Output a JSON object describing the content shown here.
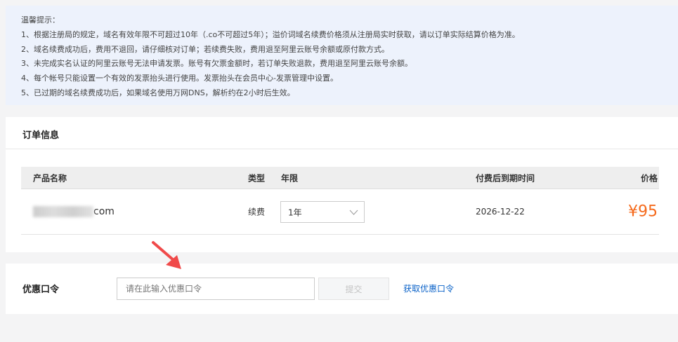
{
  "notice": {
    "title": "温馨提示：",
    "lines": [
      "1、根据注册局的规定，域名有效年限不可超过10年（.co不可超过5年）；溢价词域名续费价格须从注册局实时获取，请以订单实际结算价格为准。",
      "2、域名续费成功后，费用不退回，请仔细核对订单；若续费失败，费用退至阿里云账号余额或原付款方式。",
      "3、未完成实名认证的阿里云账号无法申请发票。账号有欠票金额时，若订单失败退款，费用退至阿里云账号余额。",
      "4、每个帐号只能设置一个有效的发票抬头进行使用。发票抬头在会员中心-发票管理中设置。",
      "5、已过期的域名续费成功后，如果域名使用万网DNS，解析约在2小时后生效。"
    ]
  },
  "order": {
    "title": "订单信息",
    "headers": {
      "product": "产品名称",
      "type": "类型",
      "years": "年限",
      "expiry": "付费后到期时间",
      "price": "价格"
    },
    "row": {
      "domain_suffix": "com",
      "type": "续费",
      "years": "1年",
      "expiry": "2026-12-22",
      "price": "¥95"
    }
  },
  "coupon": {
    "label": "优惠口令",
    "placeholder": "请在此输入优惠口令",
    "submit": "提交",
    "link": "获取优惠口令"
  },
  "colors": {
    "price": "#f56a1c",
    "link": "#0a62c8",
    "notice_bg": "#edf2fc",
    "arrow": "#f04a4a"
  }
}
